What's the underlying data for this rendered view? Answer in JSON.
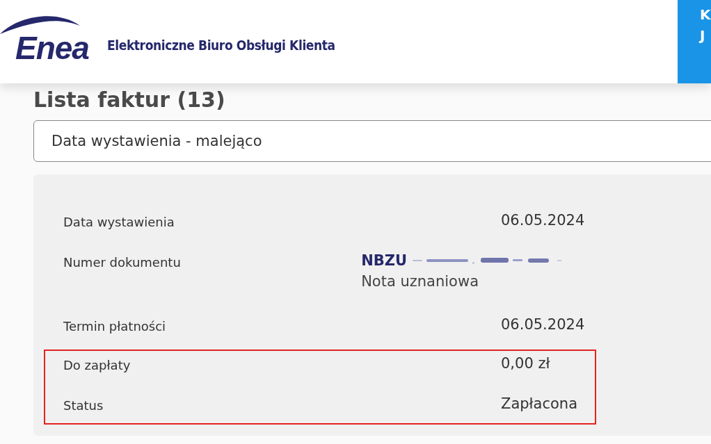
{
  "header": {
    "logo": "Enea",
    "portal_title": "Elektroniczne Biuro Obsługi Klienta",
    "side_button_lines": [
      "K",
      "J"
    ]
  },
  "heading": "Lista faktur (13)",
  "sort_select": {
    "value": "Data wystawienia - malejąco"
  },
  "invoice": {
    "rows": [
      {
        "label": "Data wystawienia",
        "value": "06.05.2024",
        "highlighted": false
      },
      {
        "label": "Numer dokumentu",
        "kind": "document",
        "value": "NBZU",
        "redacted": true,
        "subtitle": "Nota uznaniowa",
        "highlighted": false
      },
      {
        "label": "Termin płatności",
        "value": "06.05.2024",
        "highlighted": false
      },
      {
        "label": "Do zapłaty",
        "value": "0,00 zł",
        "highlighted": true
      },
      {
        "label": "Status",
        "value": "Zapłacona",
        "highlighted": true
      }
    ]
  }
}
